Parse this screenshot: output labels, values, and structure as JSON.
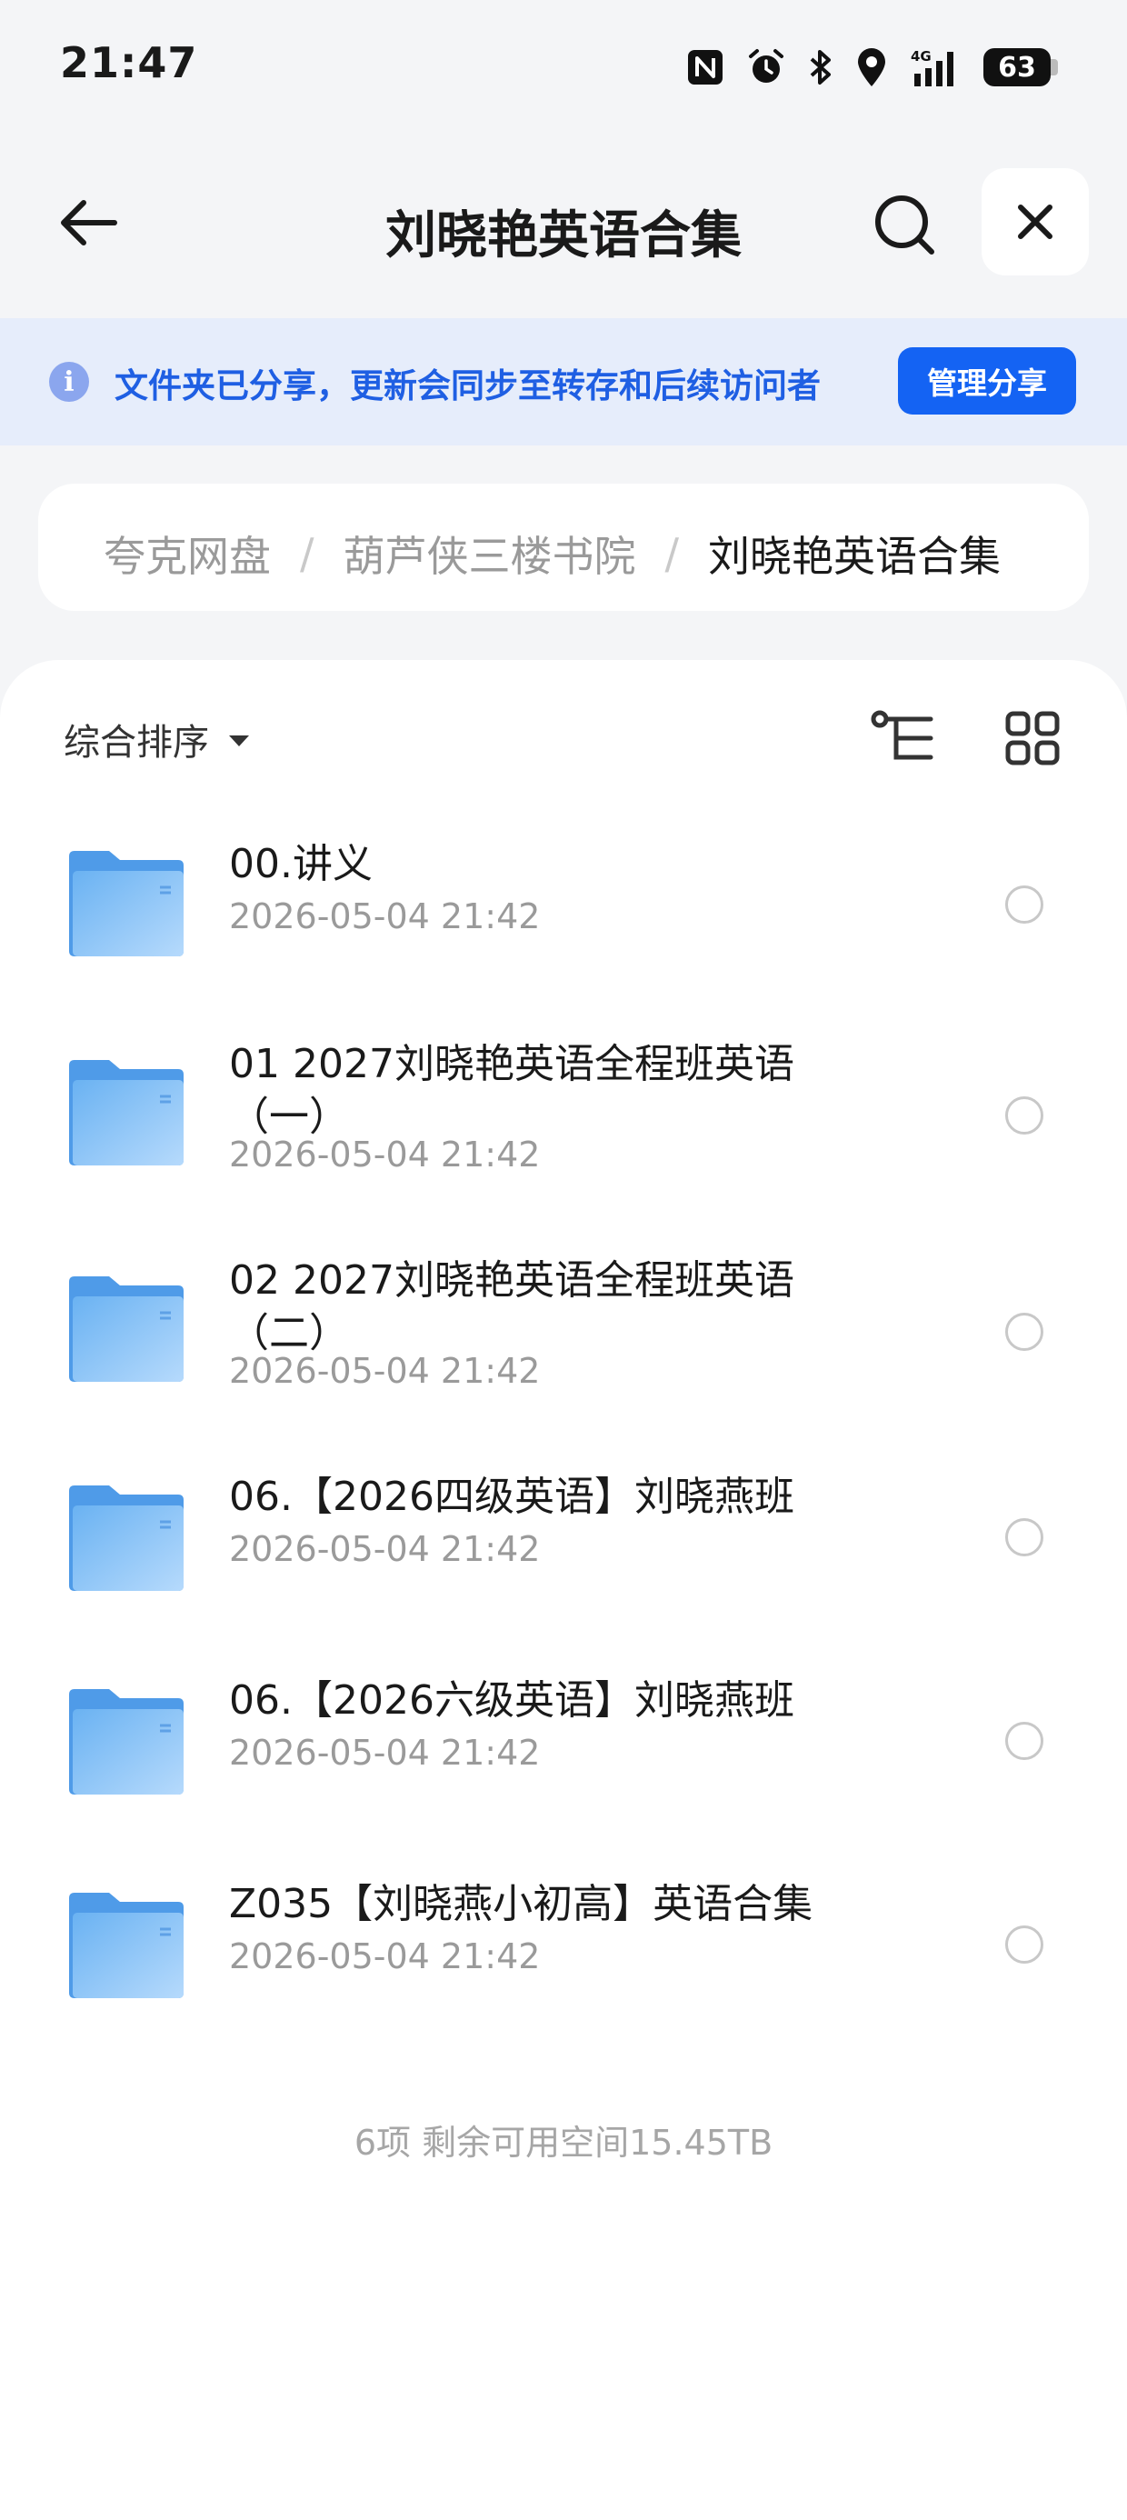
{
  "status_bar": {
    "time": "21:47",
    "network": "4G",
    "battery": "63"
  },
  "header": {
    "title": "刘晓艳英语合集"
  },
  "share_banner": {
    "text": "文件夹已分享，更新会同步至转存和后续访问者",
    "button": "管理分享"
  },
  "breadcrumb": {
    "items": [
      {
        "label": "夸克网盘"
      },
      {
        "label": "葫芦侠三楼书院"
      },
      {
        "label": "刘晓艳英语合集"
      }
    ],
    "separator": "/"
  },
  "toolbar": {
    "sort_label": "综合排序"
  },
  "files": [
    {
      "name": "00.讲义",
      "date": "2026-05-04 21:42"
    },
    {
      "name": "01 2027刘晓艳英语全程班英语（一）",
      "date": "2026-05-04 21:42"
    },
    {
      "name": "02 2027刘晓艳英语全程班英语（二）",
      "date": "2026-05-04 21:42"
    },
    {
      "name": "06.【2026四级英语】刘晓燕班",
      "date": "2026-05-04 21:42"
    },
    {
      "name": "06.【2026六级英语】刘晓燕班",
      "date": "2026-05-04 21:42"
    },
    {
      "name": "Z035【刘晓燕小初高】英语合集",
      "date": "2026-05-04 21:42"
    }
  ],
  "footer": {
    "summary": "6项 剩余可用空间15.45TB"
  },
  "colors": {
    "accent": "#1463f3",
    "banner_bg": "#e6edfb",
    "folder": "#5ea8ef"
  }
}
